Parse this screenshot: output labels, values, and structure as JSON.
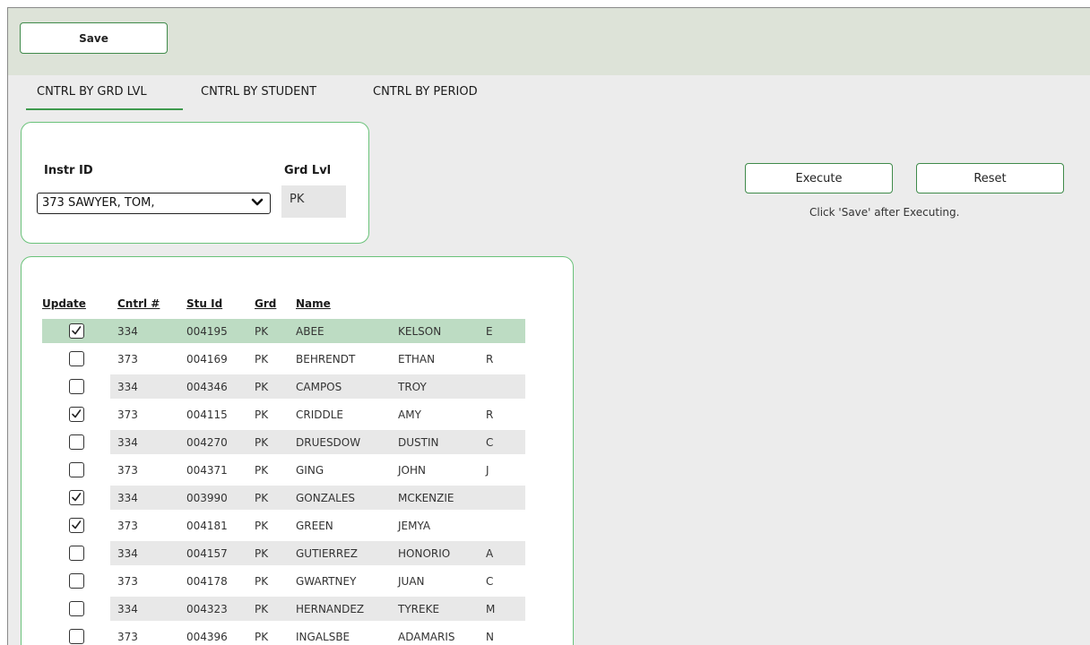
{
  "toolbar": {
    "save_label": "Save"
  },
  "tabs": [
    {
      "label": "CNTRL BY GRD LVL",
      "active": true
    },
    {
      "label": "CNTRL BY STUDENT",
      "active": false
    },
    {
      "label": "CNTRL BY PERIOD",
      "active": false
    }
  ],
  "filters": {
    "instr_label": "Instr ID",
    "instr_value": "373 SAWYER, TOM,",
    "grd_label": "Grd Lvl",
    "grd_value": "PK"
  },
  "actions": {
    "execute_label": "Execute",
    "reset_label": "Reset",
    "hint": "Click 'Save' after Executing."
  },
  "table": {
    "headers": [
      "Update",
      "Cntrl #",
      "Stu Id",
      "Grd",
      "Name"
    ],
    "rows": [
      {
        "checked": true,
        "cntrl": "334",
        "stu_id": "004195",
        "grd": "PK",
        "last": "ABEE",
        "first": "KELSON",
        "mi": "E"
      },
      {
        "checked": false,
        "cntrl": "373",
        "stu_id": "004169",
        "grd": "PK",
        "last": "BEHRENDT",
        "first": "ETHAN",
        "mi": "R"
      },
      {
        "checked": false,
        "cntrl": "334",
        "stu_id": "004346",
        "grd": "PK",
        "last": "CAMPOS",
        "first": "TROY",
        "mi": ""
      },
      {
        "checked": true,
        "cntrl": "373",
        "stu_id": "004115",
        "grd": "PK",
        "last": "CRIDDLE",
        "first": "AMY",
        "mi": "R"
      },
      {
        "checked": false,
        "cntrl": "334",
        "stu_id": "004270",
        "grd": "PK",
        "last": "DRUESDOW",
        "first": "DUSTIN",
        "mi": "C"
      },
      {
        "checked": false,
        "cntrl": "373",
        "stu_id": "004371",
        "grd": "PK",
        "last": "GING",
        "first": "JOHN",
        "mi": "J"
      },
      {
        "checked": true,
        "cntrl": "334",
        "stu_id": "003990",
        "grd": "PK",
        "last": "GONZALES",
        "first": "MCKENZIE",
        "mi": ""
      },
      {
        "checked": true,
        "cntrl": "373",
        "stu_id": "004181",
        "grd": "PK",
        "last": "GREEN",
        "first": "JEMYA",
        "mi": ""
      },
      {
        "checked": false,
        "cntrl": "334",
        "stu_id": "004157",
        "grd": "PK",
        "last": "GUTIERREZ",
        "first": "HONORIO",
        "mi": "A"
      },
      {
        "checked": false,
        "cntrl": "373",
        "stu_id": "004178",
        "grd": "PK",
        "last": "GWARTNEY",
        "first": "JUAN",
        "mi": "C"
      },
      {
        "checked": false,
        "cntrl": "334",
        "stu_id": "004323",
        "grd": "PK",
        "last": "HERNANDEZ",
        "first": "TYREKE",
        "mi": "M"
      },
      {
        "checked": false,
        "cntrl": "373",
        "stu_id": "004396",
        "grd": "PK",
        "last": "INGALSBE",
        "first": "ADAMARIS",
        "mi": "N"
      }
    ]
  },
  "colors": {
    "accent": "#3f8a4a",
    "panel_border": "#6ac27a",
    "selected_row": "#bddcc3",
    "toolbar_bg": "#dde3d8"
  }
}
